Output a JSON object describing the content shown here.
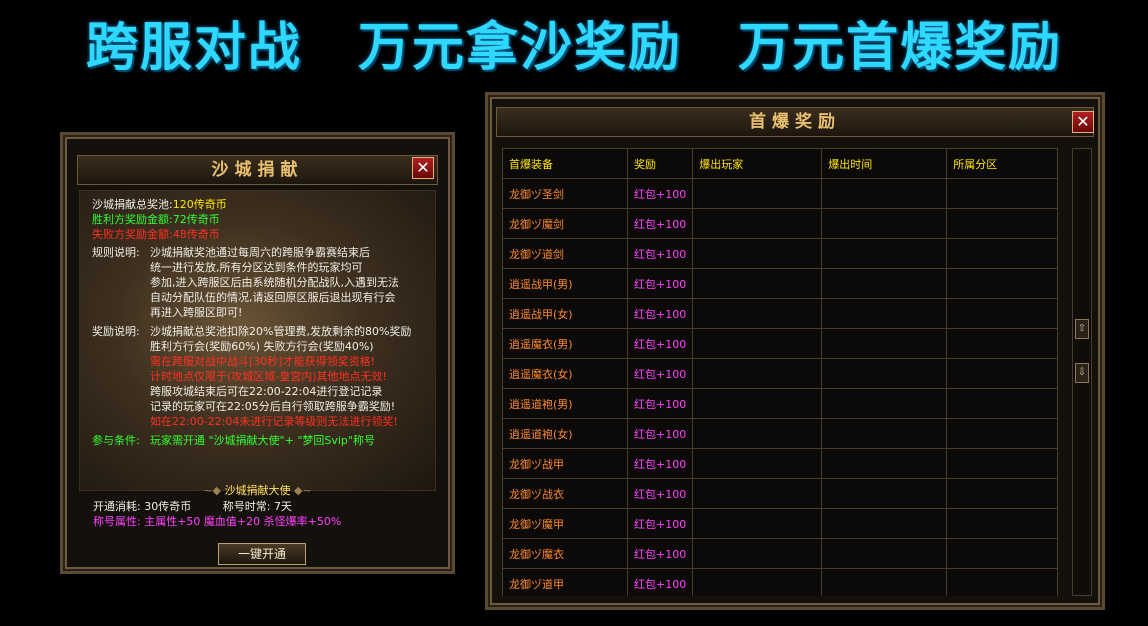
{
  "banner": {
    "part1": "跨服对战",
    "part2": "万元拿沙奖励",
    "part3": "万元首爆奖励"
  },
  "left_panel": {
    "title": "沙城捐献",
    "close": "✕",
    "pool_label": "沙城捐献总奖池:",
    "pool_value": "120传奇币",
    "winner_label": "胜利方奖励金额:",
    "winner_value": "72传奇币",
    "loser_label": "失败方奖励金额:",
    "loser_value": "48传奇币",
    "rules_label": "规则说明:",
    "rules_lines": [
      "沙城捐献奖池通过每周六的跨服争霸赛结束后",
      "统一进行发放,所有分区达到条件的玩家均可",
      "参加,进入跨服区后由系统随机分配战队,入遇到无法",
      "自动分配队伍的情况,请返回原区服后退出现有行会",
      "再进入跨服区即可!"
    ],
    "reward_label": "奖励说明:",
    "reward_lines": [
      "沙城捐献总奖池扣除20%管理费,发放剩余的80%奖励",
      "胜利方行会(奖励60%) 失败方行会(奖励40%)"
    ],
    "reward_red_lines": [
      "需在跨服对战中战斗[30秒]才能获得领奖资格!",
      "计时地点仅限于(攻城区域-皇宫内)其他地点无效!"
    ],
    "reward_white_lines": [
      "跨服攻城结束后可在22:00-22:04进行登记记录",
      "记录的玩家可在22:05分后自行领取跨服争霸奖励!"
    ],
    "reward_last_red": "如在22:00-22:04未进行记录等级则无法进行领奖!",
    "condition_label": "参与条件:",
    "condition_text": "玩家需开通 \"沙城捐献大使\"+ \"梦回Svip\"称号",
    "ambassador_title": "沙城捐献大使",
    "cost_label": "开通消耗:",
    "cost_value": "30传奇币",
    "duration_label": "称号时常:",
    "duration_value": "7天",
    "attr_label": "称号属性:",
    "attr_value": "主属性+50 魔血值+20 杀怪爆率+50%",
    "open_button": "一键开通"
  },
  "right_panel": {
    "title": "首爆奖励",
    "close": "✕",
    "headers": [
      "首爆装备",
      "奖励",
      "爆出玩家",
      "爆出时间",
      "所属分区"
    ],
    "rows": [
      {
        "equip": "龙御ヅ圣剑",
        "reward": "红包+100"
      },
      {
        "equip": "龙御ヅ魔剑",
        "reward": "红包+100"
      },
      {
        "equip": "龙御ヅ道剑",
        "reward": "红包+100"
      },
      {
        "equip": "逍遥战甲(男)",
        "reward": "红包+100"
      },
      {
        "equip": "逍遥战甲(女)",
        "reward": "红包+100"
      },
      {
        "equip": "逍遥魔衣(男)",
        "reward": "红包+100"
      },
      {
        "equip": "逍遥魔衣(女)",
        "reward": "红包+100"
      },
      {
        "equip": "逍遥道袍(男)",
        "reward": "红包+100"
      },
      {
        "equip": "逍遥道袍(女)",
        "reward": "红包+100"
      },
      {
        "equip": "龙御ヅ战甲",
        "reward": "红包+100"
      },
      {
        "equip": "龙御ヅ战衣",
        "reward": "红包+100"
      },
      {
        "equip": "龙御ヅ魔甲",
        "reward": "红包+100"
      },
      {
        "equip": "龙御ヅ魔衣",
        "reward": "红包+100"
      },
      {
        "equip": "龙御ヅ道甲",
        "reward": "红包+100"
      }
    ],
    "scroll_up": "⇧",
    "scroll_down": "⇩"
  }
}
